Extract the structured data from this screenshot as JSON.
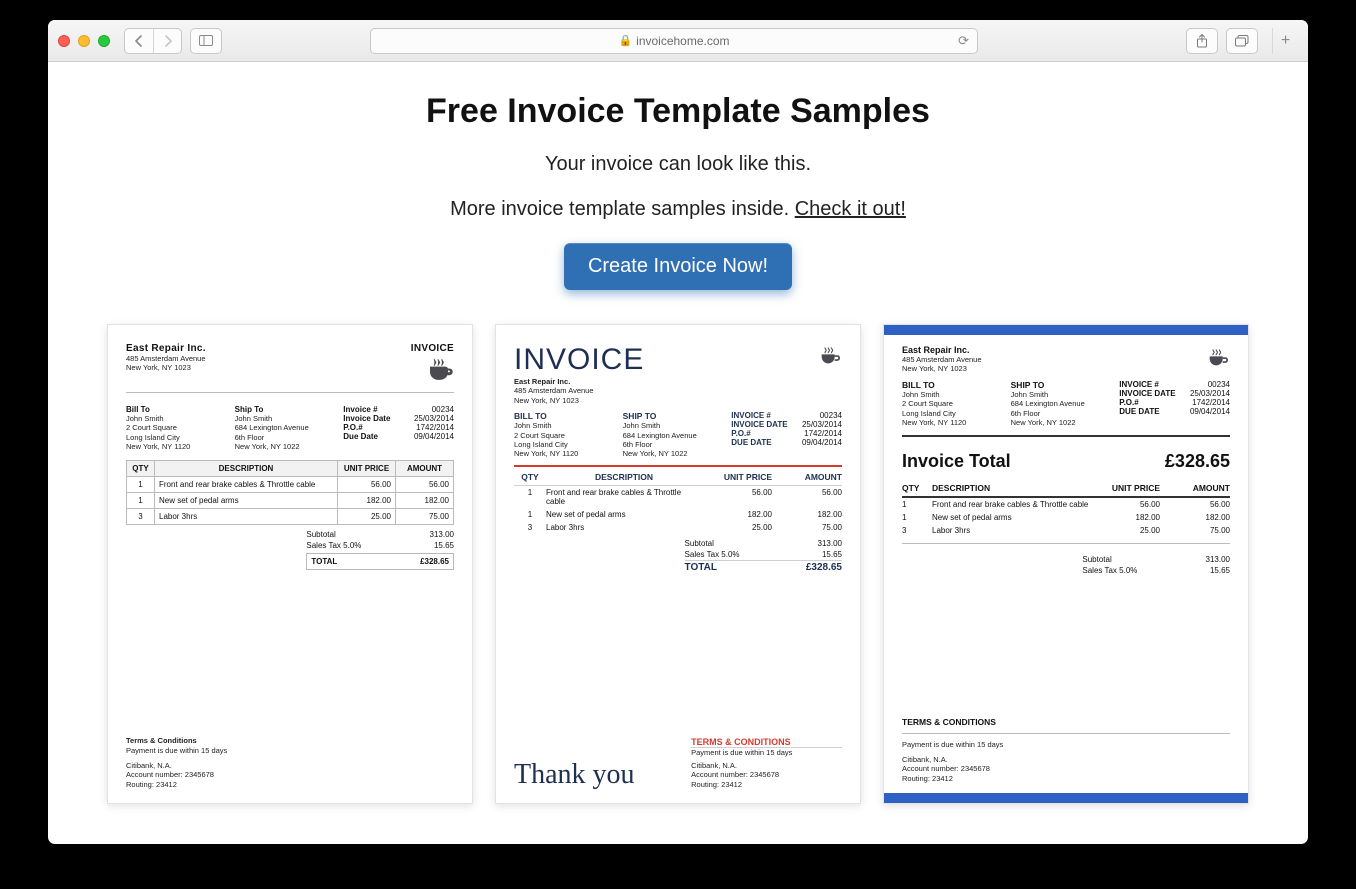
{
  "url": "invoicehome.com",
  "page": {
    "title": "Free Invoice Template Samples",
    "subtitle": "Your invoice can look like this.",
    "more_text": "More invoice template samples inside. ",
    "more_link": "Check it out!",
    "cta": "Create Invoice Now!"
  },
  "common": {
    "company": "East Repair Inc.",
    "company_addr1": "485 Amsterdam Avenue",
    "company_addr2": "New York, NY 1023",
    "invoice_word": "INVOICE",
    "bill_to_label": "Bill To",
    "ship_to_label": "Ship To",
    "bill_to": {
      "name": "John Smith",
      "l1": "2 Court Square",
      "l2": "Long Island City",
      "l3": "New York, NY 1120"
    },
    "ship_to": {
      "name": "John Smith",
      "l1": "684 Lexington Avenue",
      "l2": "6th Floor",
      "l3": "New York, NY 1022"
    },
    "meta": {
      "invoice_no_label": "Invoice #",
      "invoice_no": "00234",
      "invoice_date_label": "Invoice Date",
      "invoice_date": "25/03/2014",
      "po_label": "P.O.#",
      "po": "1742/2014",
      "due_label": "Due Date",
      "due": "09/04/2014"
    },
    "headers": {
      "qty": "QTY",
      "desc": "DESCRIPTION",
      "unit": "UNIT PRICE",
      "amount": "AMOUNT"
    },
    "items": [
      {
        "qty": "1",
        "desc": "Front and rear brake cables & Throttle cable",
        "unit": "56.00",
        "amount": "56.00"
      },
      {
        "qty": "1",
        "desc": "New set of pedal arms",
        "unit": "182.00",
        "amount": "182.00"
      },
      {
        "qty": "3",
        "desc": "Labor 3hrs",
        "unit": "25.00",
        "amount": "75.00"
      }
    ],
    "subtotal_label": "Subtotal",
    "subtotal": "313.00",
    "tax_label": "Sales Tax 5.0%",
    "tax": "15.65",
    "total_label": "TOTAL",
    "total": "£328.65",
    "tc_title": "Terms & Conditions",
    "tc_line": "Payment is due within 15 days",
    "bank1": "Citibank, N.A.",
    "bank2": "Account number: 2345678",
    "bank3": "Routing: 23412"
  },
  "t2": {
    "bill_to_label": "BILL TO",
    "ship_to_label": "SHIP TO",
    "invoice_no_label": "INVOICE #",
    "invoice_date_label": "INVOICE DATE",
    "due_label": "DUE DATE",
    "thanks": "Thank you",
    "tc_title": "TERMS & CONDITIONS"
  },
  "t3": {
    "bill_to_label": "BILL TO",
    "ship_to_label": "SHIP TO",
    "invoice_no_label": "INVOICE #",
    "invoice_date_label": "INVOICE DATE",
    "due_label": "DUE DATE",
    "big_total_label": "Invoice Total",
    "tc_title": "TERMS & CONDITIONS"
  }
}
